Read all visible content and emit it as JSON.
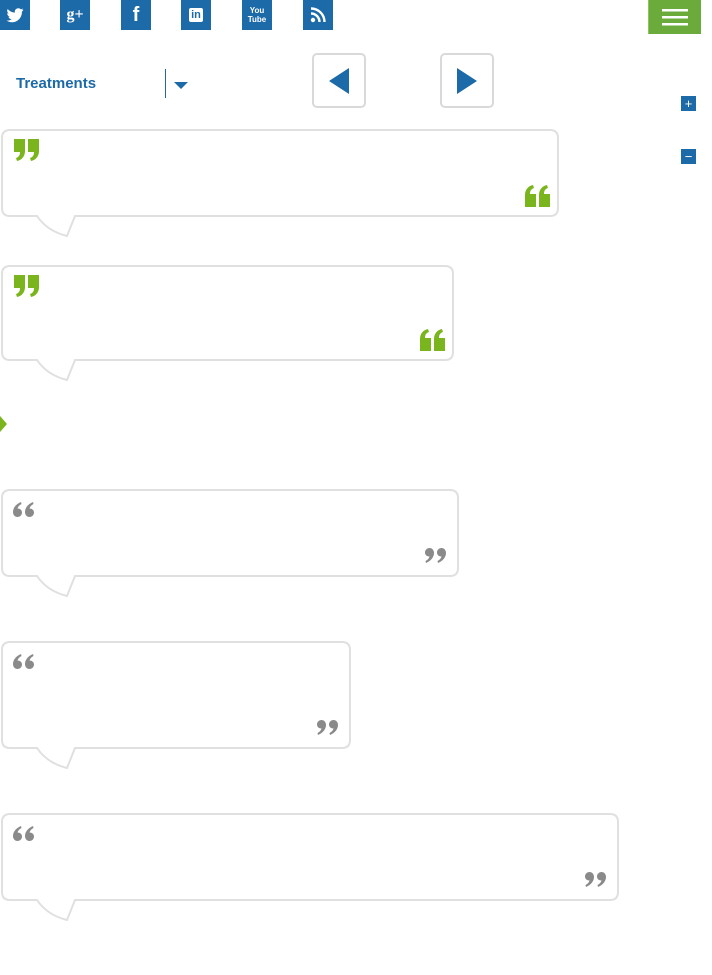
{
  "social": [
    {
      "icon": "twitter-icon",
      "label": ""
    },
    {
      "icon": "google-plus-icon",
      "label": "g+"
    },
    {
      "icon": "facebook-icon",
      "label": "f"
    },
    {
      "icon": "linkedin-icon",
      "label": "in"
    },
    {
      "icon": "youtube-icon",
      "label": "You Tube"
    },
    {
      "icon": "rss-icon",
      "label": ""
    }
  ],
  "menu": {
    "icon": "hamburger-menu-icon"
  },
  "filter": {
    "label": "Treatments",
    "icon": "chevron-down-icon"
  },
  "pager": {
    "prev_icon": "arrow-left-icon",
    "next_icon": "arrow-right-icon"
  },
  "zoom": {
    "in_label": "+",
    "out_label": "−"
  },
  "colors": {
    "brand_blue": "#1d6aa8",
    "brand_green": "#7ab51d",
    "menu_green": "#6bab3c",
    "bubble_border": "#e0e0e0",
    "quote_grey": "#8a8a8a"
  },
  "testimonials": [
    {
      "quote_color": "green",
      "text": ""
    },
    {
      "quote_color": "green",
      "text": ""
    },
    {
      "quote_color": "grey",
      "text": ""
    },
    {
      "quote_color": "grey",
      "text": ""
    },
    {
      "quote_color": "grey",
      "text": ""
    }
  ]
}
